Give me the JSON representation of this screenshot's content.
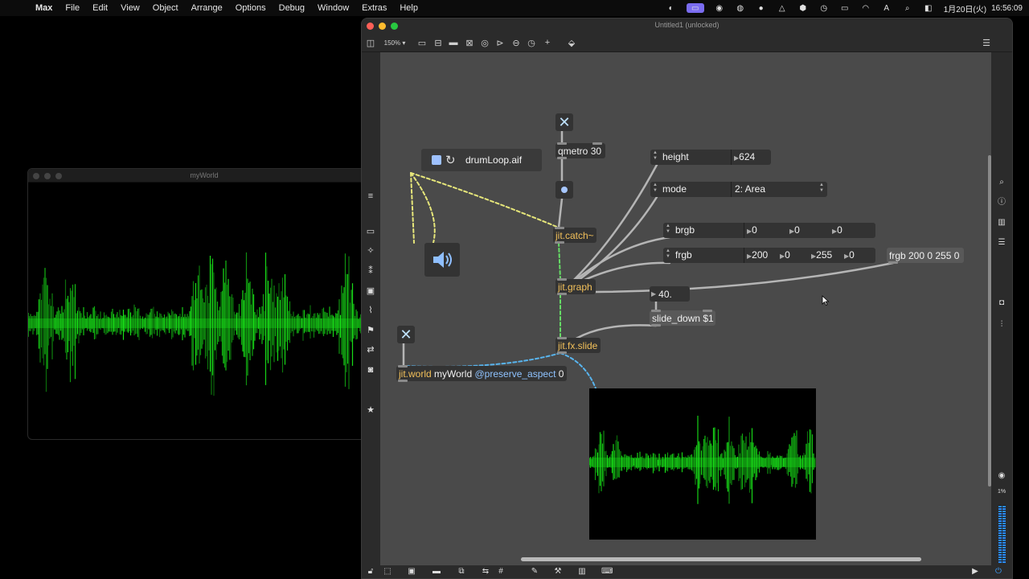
{
  "menubar": {
    "app": "Max",
    "items": [
      "File",
      "Edit",
      "View",
      "Object",
      "Arrange",
      "Options",
      "Debug",
      "Window",
      "Extras",
      "Help"
    ],
    "date": "1月20日(火)",
    "time": "16:56:09",
    "input_mode": "A"
  },
  "myworld_window": {
    "title": "myWorld"
  },
  "patcher": {
    "title": "Untitled1 (unlocked)",
    "zoom": "150%",
    "cpu": "1%",
    "objects": {
      "qmetro": {
        "name": "qmetro",
        "arg": "30"
      },
      "playlist": {
        "file": "drumLoop.aif"
      },
      "height": {
        "label": "height",
        "value": "624"
      },
      "mode": {
        "label": "mode",
        "value": "2: Area"
      },
      "brgb": {
        "label": "brgb",
        "values": [
          "0",
          "0",
          "0"
        ]
      },
      "frgb": {
        "label": "frgb",
        "values": [
          "200",
          "0",
          "255",
          "0"
        ]
      },
      "frgb_msg": "frgb 200 0 255 0",
      "jit_catch": "jit.catch~",
      "jit_graph": "jit.graph",
      "num_slide": "40.",
      "slide_msg": "slide_down $1",
      "jit_fx_slide": "jit.fx.slide",
      "jit_world": {
        "name": "jit.world",
        "arg": "myWorld",
        "attr": "@preserve_aspect",
        "attr_val": "0"
      }
    }
  },
  "colors": {
    "waveform": "#19e619",
    "patch_cord": "#b5b5b5",
    "signal_cord": "#e6e67a",
    "matrix_cord": "#66dd66",
    "world_cord": "#58b4ee"
  },
  "icons": [
    "apple-icon",
    "wifi-icon",
    "search-icon",
    "battery-icon",
    "close-icon",
    "speaker-icon",
    "loop-icon",
    "star-icon",
    "lock-icon",
    "info-icon"
  ]
}
